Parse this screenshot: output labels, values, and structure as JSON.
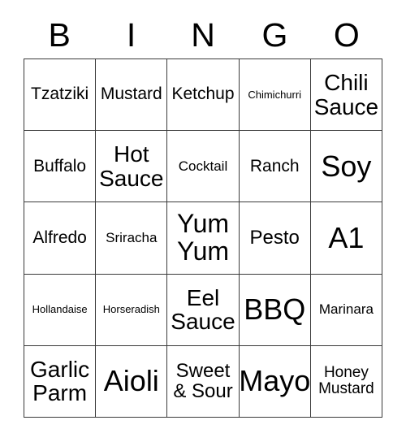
{
  "card": {
    "title": "BINGO",
    "header_letters": [
      "B",
      "I",
      "N",
      "G",
      "O"
    ],
    "border_color": "#3a3a3a",
    "cell_background": "#ffffff",
    "text_color": "#000000",
    "rows": 5,
    "columns": 5,
    "grid": [
      [
        {
          "text": "Tzatziki",
          "size": "s-md"
        },
        {
          "text": "Mustard",
          "size": "s-md"
        },
        {
          "text": "Ketchup",
          "size": "s-md"
        },
        {
          "text": "Chimichurri",
          "size": "s-xs"
        },
        {
          "text": "Chili\nSauce",
          "size": "s-lg"
        }
      ],
      [
        {
          "text": "Buffalo",
          "size": "s-md"
        },
        {
          "text": "Hot\nSauce",
          "size": "s-lg"
        },
        {
          "text": "Cocktail",
          "size": "s-sm"
        },
        {
          "text": "Ranch",
          "size": "s-md"
        },
        {
          "text": "Soy",
          "size": "s-xxl"
        }
      ],
      [
        {
          "text": "Alfredo",
          "size": "s-md"
        },
        {
          "text": "Sriracha",
          "size": "s-sm"
        },
        {
          "text": "Yum\nYum",
          "size": "s-xl"
        },
        {
          "text": "Pesto",
          "size": "s-mdp"
        },
        {
          "text": "A1",
          "size": "s-xxl"
        }
      ],
      [
        {
          "text": "Hollandaise",
          "size": "s-xs"
        },
        {
          "text": "Horseradish",
          "size": "s-xs"
        },
        {
          "text": "Eel\nSauce",
          "size": "s-lg"
        },
        {
          "text": "BBQ",
          "size": "s-xxl"
        },
        {
          "text": "Marinara",
          "size": "s-sm"
        }
      ],
      [
        {
          "text": "Garlic\nParm",
          "size": "s-lg"
        },
        {
          "text": "Aioli",
          "size": "s-xxl"
        },
        {
          "text": "Sweet\n& Sour",
          "size": "s-mdp"
        },
        {
          "text": "Mayo",
          "size": "s-xxl"
        },
        {
          "text": "Honey\nMustard",
          "size": "s-smp"
        }
      ]
    ]
  }
}
